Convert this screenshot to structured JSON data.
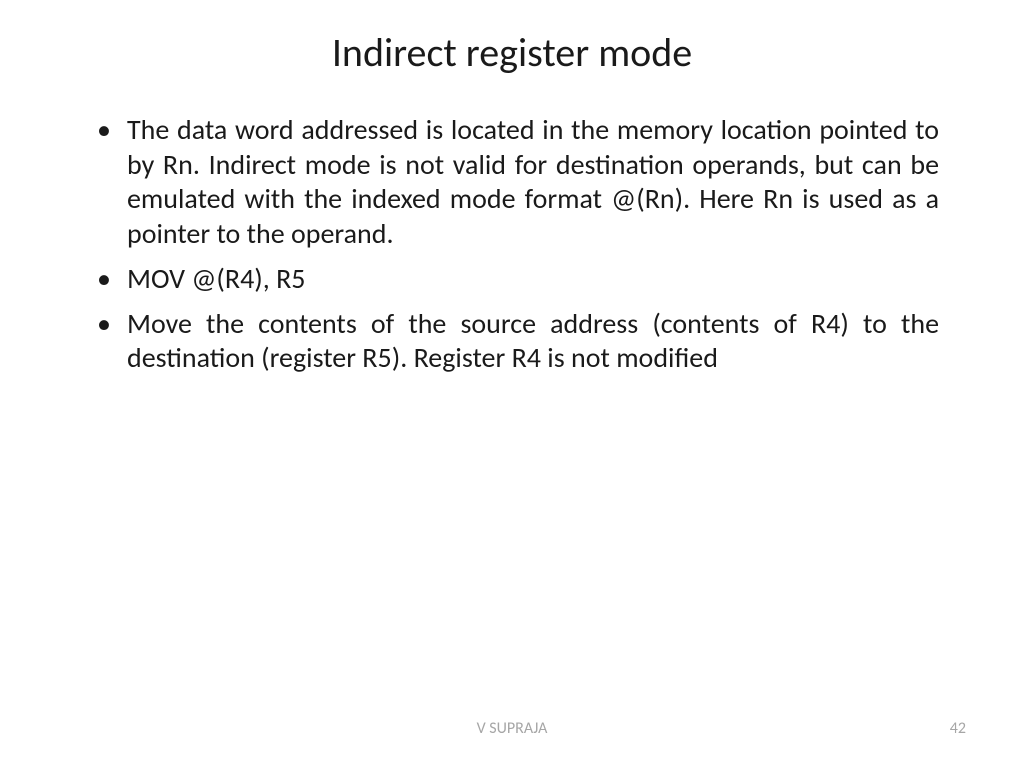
{
  "title": "Indirect register mode",
  "bullets": [
    "The data word addressed is located in the memory location pointed  to by Rn. Indirect mode is not valid for destination operands, but can be emulated with the indexed mode format @(Rn). Here Rn is used as a pointer to the operand.",
    "MOV @(R4), R5",
    "Move the contents of the source address (contents of R4) to the destination (register R5). Register R4 is not modified"
  ],
  "footer": {
    "author": "V SUPRAJA",
    "page": "42"
  }
}
